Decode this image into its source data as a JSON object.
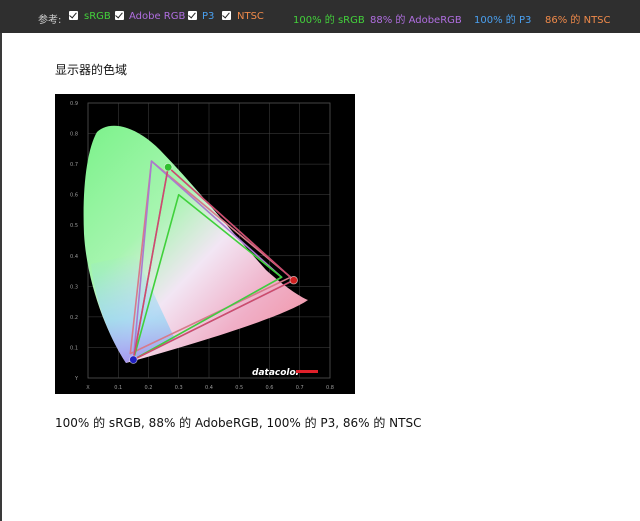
{
  "topbar": {
    "reference_label": "参考:",
    "checks": [
      {
        "label": "sRGB",
        "color": "#43d13b",
        "checked": true
      },
      {
        "label": "Adobe RGB",
        "color": "#b06ee0",
        "checked": true
      },
      {
        "label": "P3",
        "color": "#4aa0f0",
        "checked": true
      },
      {
        "label": "NTSC",
        "color": "#f08a4a",
        "checked": true
      }
    ],
    "stats": [
      {
        "text": "100% 的 sRGB",
        "color": "#43d13b"
      },
      {
        "text": "88% 的 AdobeRGB",
        "color": "#b06ee0"
      },
      {
        "text": "100% 的 P3",
        "color": "#4aa0f0"
      },
      {
        "text": "86% 的 NTSC",
        "color": "#f08a4a"
      }
    ]
  },
  "main": {
    "heading": "显示器的色域",
    "summary": "100% 的 sRGB, 88% 的 AdobeRGB, 100% 的 P3, 86% 的 NTSC"
  },
  "chart_data": {
    "type": "scatter",
    "xticks": [
      "X",
      "0.1",
      "0.2",
      "0.3",
      "0.4",
      "0.5",
      "0.6",
      "0.7",
      "0.8"
    ],
    "yticks": [
      "Y",
      "0.1",
      "0.2",
      "0.3",
      "0.4",
      "0.5",
      "0.6",
      "0.7",
      "0.8",
      "0.9"
    ],
    "xlim": [
      0,
      0.8
    ],
    "ylim": [
      0,
      0.9
    ],
    "grid": true,
    "watermark": "datacolor",
    "gamuts": [
      {
        "name": "NTSC",
        "color": "#d77a8a",
        "points": [
          [
            0.67,
            0.33
          ],
          [
            0.21,
            0.71
          ],
          [
            0.14,
            0.08
          ]
        ]
      },
      {
        "name": "Adobe RGB",
        "color": "#a97ad0",
        "points": [
          [
            0.64,
            0.33
          ],
          [
            0.21,
            0.71
          ],
          [
            0.15,
            0.06
          ]
        ]
      },
      {
        "name": "P3",
        "color": "#6a9ad0",
        "points": [
          [
            0.68,
            0.32
          ],
          [
            0.265,
            0.69
          ],
          [
            0.15,
            0.06
          ]
        ]
      },
      {
        "name": "sRGB",
        "color": "#3fd13b",
        "points": [
          [
            0.64,
            0.33
          ],
          [
            0.3,
            0.6
          ],
          [
            0.15,
            0.06
          ]
        ]
      },
      {
        "name": "display",
        "color": "#d24a6a",
        "points": [
          [
            0.68,
            0.32
          ],
          [
            0.265,
            0.69
          ],
          [
            0.15,
            0.06
          ]
        ]
      }
    ],
    "primaries": [
      {
        "name": "red",
        "x": 0.68,
        "y": 0.32,
        "color": "#d02020"
      },
      {
        "name": "green",
        "x": 0.265,
        "y": 0.69,
        "color": "#30c030"
      },
      {
        "name": "blue",
        "x": 0.15,
        "y": 0.06,
        "color": "#2020c0"
      }
    ]
  }
}
